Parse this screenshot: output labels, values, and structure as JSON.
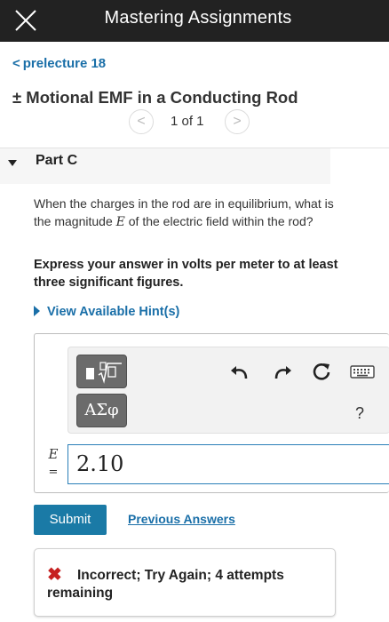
{
  "app": {
    "title": "Mastering Assignments"
  },
  "nav": {
    "back_label": "prelecture 18"
  },
  "problem": {
    "title": "± Motional EMF in a Conducting Rod"
  },
  "pager": {
    "prev": "<",
    "next": ">",
    "count": "1 of 1"
  },
  "part": {
    "label": "Part C"
  },
  "question": {
    "text_before": "When the charges in the rod are in equilibrium, what is the magnitude ",
    "variable": "E",
    "text_after": " of the electric field within the rod?"
  },
  "instructions": "Express your answer in volts per meter to at least three significant figures.",
  "hint": {
    "label": "View Available Hint(s)"
  },
  "toolbar": {
    "template_label": "■√□",
    "symbols_label": "ΑΣφ",
    "help_label": "?",
    "icons": [
      "undo-icon",
      "redo-icon",
      "reset-icon",
      "keyboard-icon"
    ]
  },
  "answer": {
    "variable": "E",
    "equals": "=",
    "value": "2.10"
  },
  "actions": {
    "submit_label": "Submit",
    "previous_answers_label": "Previous Answers"
  },
  "feedback": {
    "icon": "x-icon",
    "message": "Incorrect; Try Again; 4 attempts remaining",
    "color": "#c62020"
  },
  "colors": {
    "link": "#1a6fa8",
    "submit": "#1a7aa6",
    "topbar": "#222222",
    "input_border": "#2a7fb8"
  }
}
